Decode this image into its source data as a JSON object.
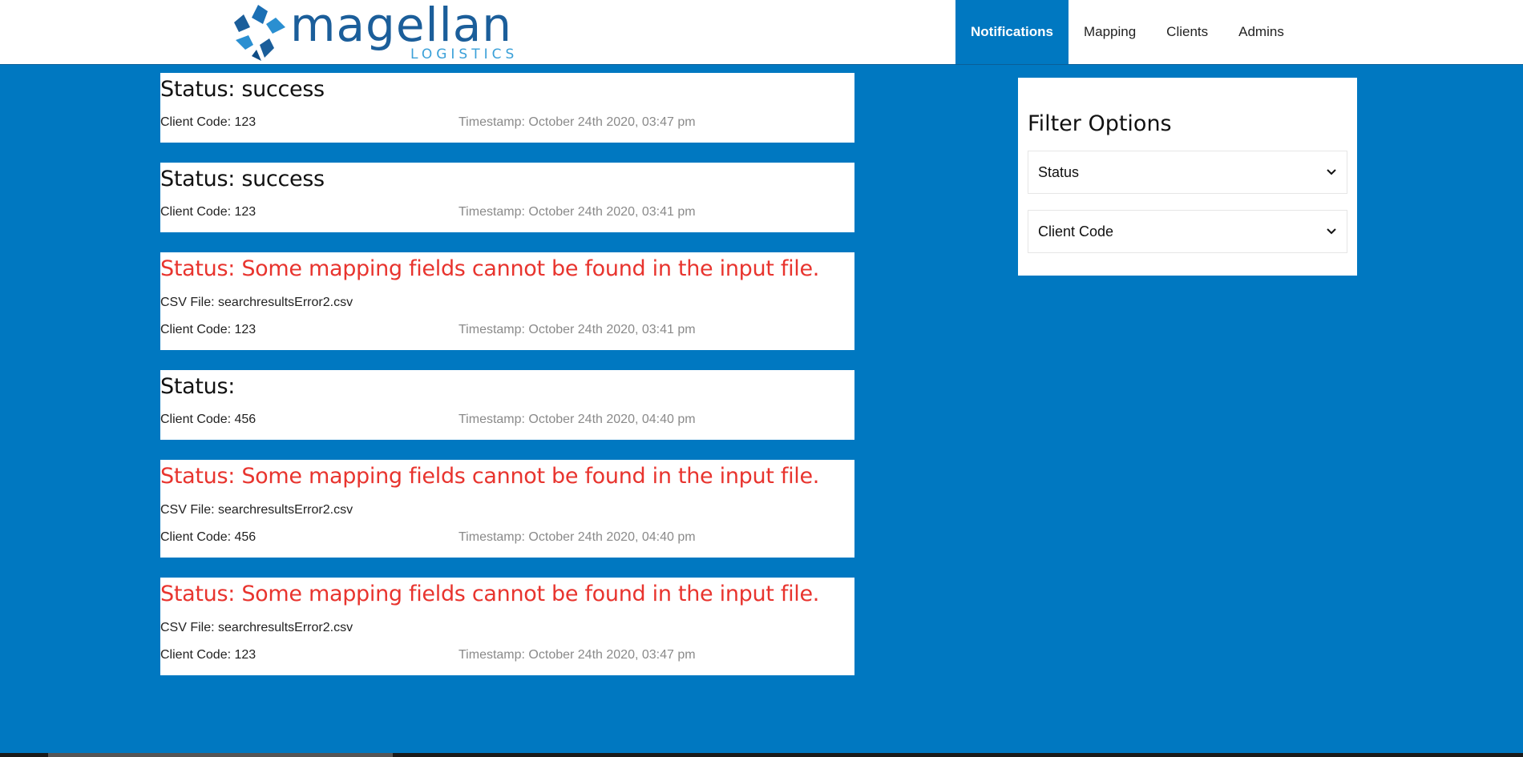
{
  "brand": {
    "name": "magellan",
    "subtitle": "LOGISTICS",
    "accent": "#0078c1",
    "error_color": "#e8342e"
  },
  "nav": {
    "items": [
      {
        "label": "Notifications",
        "active": true
      },
      {
        "label": "Mapping"
      },
      {
        "label": "Clients"
      },
      {
        "label": "Admins"
      }
    ]
  },
  "notifications": [
    {
      "status": "Status: success",
      "client": "Client Code: 123",
      "timestamp": "Timestamp: October 24th 2020, 03:47 pm"
    },
    {
      "status": "Status: success",
      "client": "Client Code: 123",
      "timestamp": "Timestamp: October 24th 2020, 03:41 pm"
    },
    {
      "status": "Status: Some mapping fields cannot be found in the input file.",
      "csv": "CSV File: searchresultsError2.csv",
      "client": "Client Code: 123",
      "timestamp": "Timestamp: October 24th 2020, 03:41 pm"
    },
    {
      "status": "Status:",
      "client": "Client Code: 456",
      "timestamp": "Timestamp: October 24th 2020, 04:40 pm"
    },
    {
      "status": "Status: Some mapping fields cannot be found in the input file.",
      "csv": "CSV File: searchresultsError2.csv",
      "client": "Client Code: 456",
      "timestamp": "Timestamp: October 24th 2020, 04:40 pm"
    },
    {
      "status": "Status: Some mapping fields cannot be found in the input file.",
      "csv": "CSV File: searchresultsError2.csv",
      "client": "Client Code: 123",
      "timestamp": "Timestamp: October 24th 2020, 03:47 pm"
    }
  ],
  "filter": {
    "title": "Filter Options",
    "status_select": "Status",
    "client_select": "Client Code"
  }
}
